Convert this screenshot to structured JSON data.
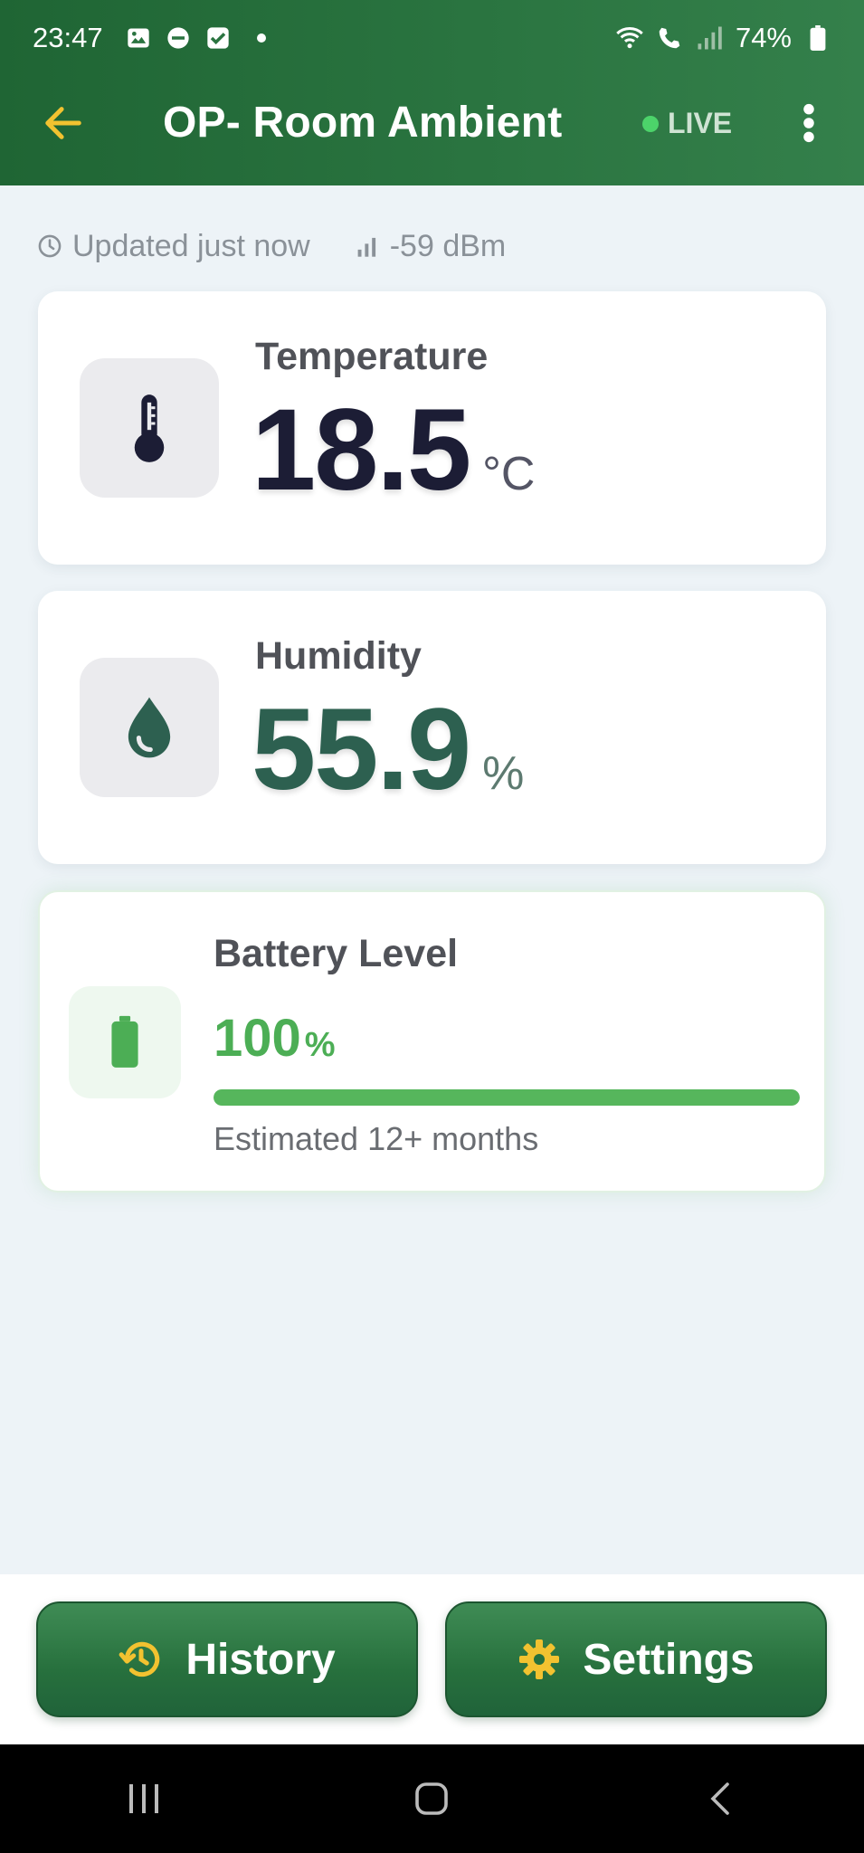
{
  "status_bar": {
    "time": "23:47",
    "battery_text": "74%",
    "icons": [
      "image-icon",
      "do-not-disturb-icon",
      "checkbox-icon",
      "wifi-icon",
      "wifi-calling-icon",
      "cell-signal-icon",
      "battery-icon"
    ]
  },
  "app_bar": {
    "title": "OP- Room Ambient",
    "live_label": "LIVE",
    "back_icon": "arrow-left-icon",
    "menu_icon": "more-vertical-icon"
  },
  "meta": {
    "updated": "Updated just now",
    "signal": "-59 dBm"
  },
  "cards": {
    "temperature": {
      "label": "Temperature",
      "value": "18.5",
      "unit": "°C",
      "icon": "thermometer-icon"
    },
    "humidity": {
      "label": "Humidity",
      "value": "55.9",
      "unit": "%",
      "icon": "water-drop-icon"
    },
    "battery": {
      "label": "Battery Level",
      "value": "100",
      "unit": "%",
      "level_percent": 100,
      "estimate": "Estimated 12+ months",
      "icon": "battery-icon"
    }
  },
  "actions": {
    "history_label": "History",
    "settings_label": "Settings"
  },
  "colors": {
    "header_green": "#2a7440",
    "accent_yellow": "#f2c230",
    "battery_green": "#56b65c",
    "live_dot": "#4cd36a"
  }
}
